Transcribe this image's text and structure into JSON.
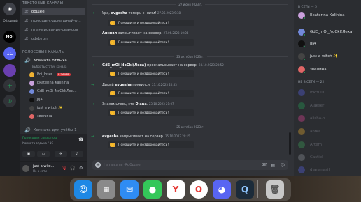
{
  "rail": {
    "overview_label": "Обзорный",
    "server1": "MOI",
    "server2": "1С"
  },
  "sidebar": {
    "text_category": "ТЕКСТОВЫЕ КАНАЛЫ",
    "text_channels": [
      "общее",
      "помощь-с-домашней-р...",
      "планирование-сеансов",
      "оффтоп"
    ],
    "voice_category": "ГОЛОСОВЫЕ КАНАЛЫ",
    "voice_channel": "Комната отдыха",
    "voice_status": "Выбрать статус канала",
    "voice_users": [
      "Poi_loser",
      "Ekaterina Kalinina",
      "GdE_mOi_NoCkI(Лех...",
      "JIJA",
      "just a witch ✨",
      "звелина"
    ],
    "live_badge": "В ЭФИРЕ",
    "voice_channel2": "Комната для учёбы 1",
    "connection": "Голосовая связь под",
    "connection_sub": "Комната отдыха / 1С",
    "user_name": "just a witc...",
    "user_status": "Не в сети"
  },
  "chat": {
    "dates": [
      "27 июня 2023 г.",
      "23 октября 2023 г.",
      "25 октября 2023 г."
    ],
    "messages": [
      {
        "text_a": "Ура, ",
        "user": "evgesha",
        "text_b": " теперь с нами!",
        "ts": "27.06.2023 9:38",
        "sticker": "Помашите и поздоровайтесь!"
      },
      {
        "text_a": "",
        "user": "Анннял",
        "text_b": " запрыгивает на сервер.",
        "ts": "27.06.2023 10:04",
        "sticker": "Помашите и поздоровайтесь!"
      },
      {
        "text_a": "",
        "user": "GdE_mOi_NoCkI(Леха)",
        "text_b": " проскальзывает на сервер.",
        "ts": "23.10.2023 20:52",
        "sticker": "Помашите и поздоровайтесь!"
      },
      {
        "text_a": "Дикий ",
        "user": "evgesha",
        "text_b": " появился.",
        "ts": "23.10.2023 20:53",
        "sticker": "Помашите и поздоровайтесь!"
      },
      {
        "text_a": "Знакомьтесь, это ",
        "user": "Diana",
        "text_b": ".",
        "ts": "23.10.2023 21:07",
        "sticker": "Помашите и поздоровайтесь!"
      },
      {
        "text_a": "",
        "user": "evgesha",
        "text_b": " запрыгивает на сервер.",
        "ts": "25.10.2023 20:15",
        "sticker": "Помашите и поздоровайтесь!"
      }
    ],
    "input_placeholder": "Написать #общее"
  },
  "members": {
    "online_header": "В СЕТИ — 5",
    "online": [
      "Ekaterina Kalinina",
      "GdE_mOi_NoCkI(Леха)",
      "JIJA",
      "just a witch ✨",
      "звелина"
    ],
    "offline_header": "НЕ В СЕТИ — 22",
    "offline": [
      "idk3000",
      "Alakser",
      "alisha.n",
      "anfka",
      "Artem",
      "Castiel",
      "diananasil"
    ]
  },
  "dock": [
    "Finder",
    "Launchpad",
    "Mail",
    "Messages",
    "Yandex",
    "Opera",
    "Discord",
    "QuickTime",
    "Trash"
  ]
}
